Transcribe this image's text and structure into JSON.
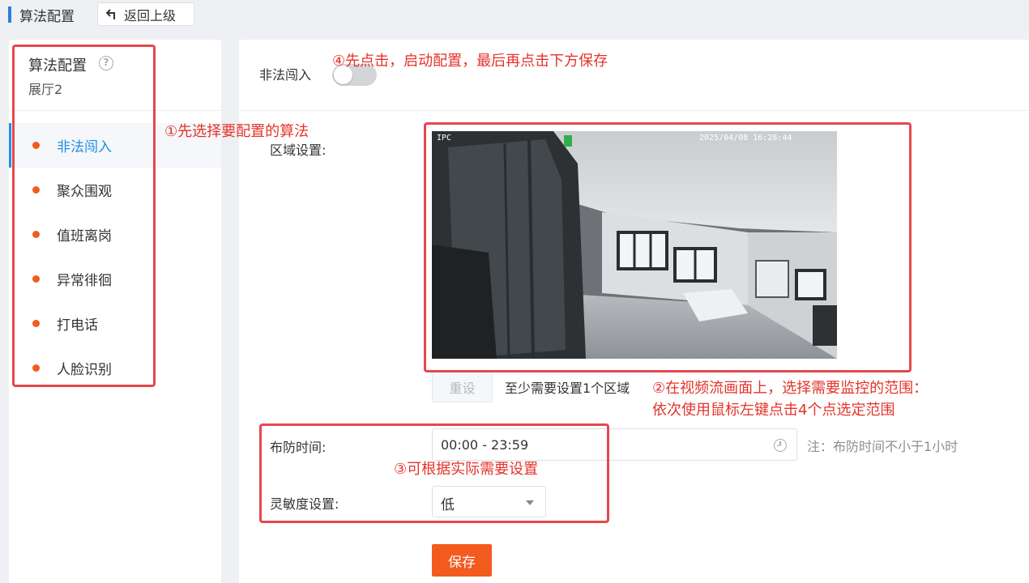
{
  "topbar": {
    "title": "算法配置",
    "back_label": "返回上级"
  },
  "sidebar": {
    "title": "算法配置",
    "subtitle": "展厅2",
    "items": [
      {
        "label": "非法闯入"
      },
      {
        "label": "聚众围观"
      },
      {
        "label": "值班离岗"
      },
      {
        "label": "异常徘徊"
      },
      {
        "label": "打电话"
      },
      {
        "label": "人脸识别"
      }
    ]
  },
  "main": {
    "toggle_label": "非法闯入",
    "toggle_on": false,
    "region_label": "区域设置:",
    "video": {
      "camera_text": "IPC",
      "timestamp": "2025/04/08 16:28:44"
    },
    "reset_label": "重设",
    "region_hint": "至少需要设置1个区域",
    "time_label": "布防时间:",
    "time_value": "00:00 - 23:59",
    "time_note": "注：布防时间不小于1小时",
    "sensitivity_label": "灵敏度设置:",
    "sensitivity_value": "低",
    "save_label": "保存"
  },
  "annotations": {
    "step1": "①先选择要配置的算法",
    "step2_line1": "②在视频流画面上，选择需要监控的范围：",
    "step2_line2": "依次使用鼠标左键点击4个点选定范围",
    "step3": "③可根据实际需要设置",
    "step4": "④先点击，启动配置，最后再点击下方保存"
  },
  "colors": {
    "accent_blue": "#1e8ee4",
    "accent_orange": "#f25a1e",
    "annotation_red": "#e5332a"
  }
}
